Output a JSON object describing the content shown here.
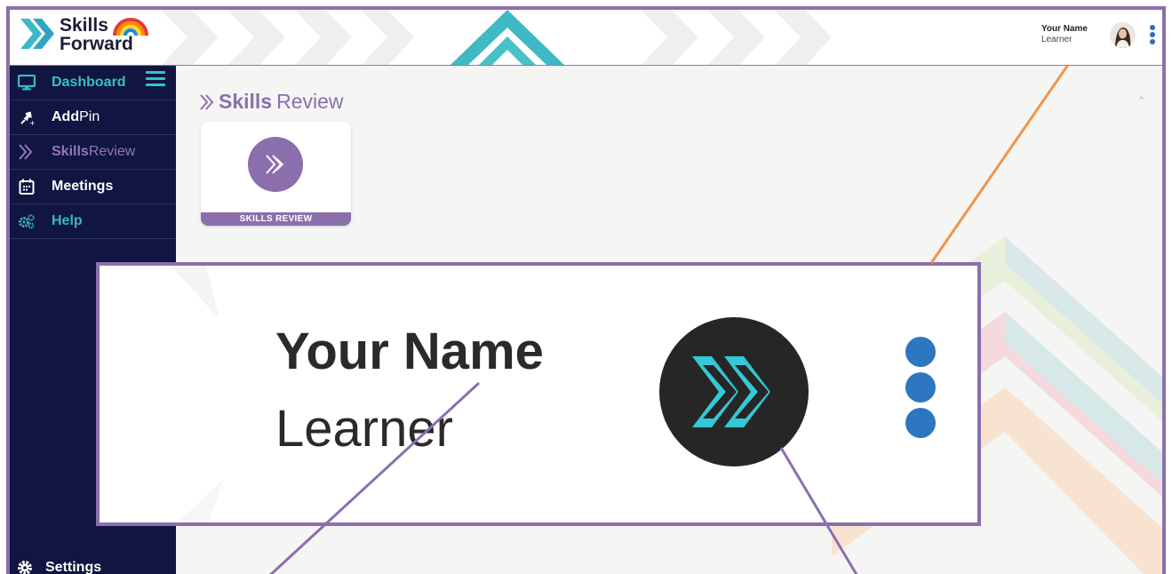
{
  "brand": {
    "name_line1": "Skills",
    "name_line2": "Forward",
    "colors": {
      "purple": "#8b6fad",
      "navy": "#101541",
      "teal": "#35c0c6",
      "blue": "#2c6fb7",
      "orange": "#f0954a"
    }
  },
  "header": {
    "user_name": "Your Name",
    "user_role": "Learner",
    "avatar_icon": "user-photo",
    "menu_icon": "kebab-vertical-icon"
  },
  "sidebar": {
    "items": [
      {
        "icon": "monitor-icon",
        "label_bold": "Dashboard",
        "label_rest": ""
      },
      {
        "icon": "pin-icon",
        "label_bold": "Add",
        "label_rest": "Pin"
      },
      {
        "icon": "chevrons-icon",
        "label_bold": "Skills",
        "label_rest": "Review"
      },
      {
        "icon": "calendar-icon",
        "label_bold": "Meetings",
        "label_rest": ""
      },
      {
        "icon": "gears-icon",
        "label_bold": "Help",
        "label_rest": ""
      }
    ],
    "settings_label": "Settings"
  },
  "main": {
    "section_title_bold": "Skills",
    "section_title_rest": "Review",
    "card_label": "SKILLS REVIEW"
  },
  "zoom": {
    "user_name": "Your Name",
    "user_role": "Learner"
  }
}
